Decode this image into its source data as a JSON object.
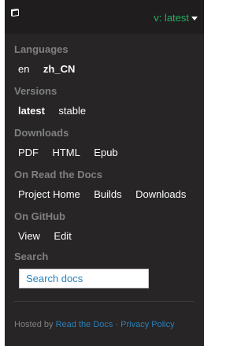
{
  "header": {
    "icon": "book-icon",
    "current_version_label": "v: latest"
  },
  "languages": {
    "heading": "Languages",
    "items": [
      "en",
      "zh_CN"
    ]
  },
  "versions": {
    "heading": "Versions",
    "items": [
      "latest",
      "stable"
    ]
  },
  "downloads": {
    "heading": "Downloads",
    "items": [
      "PDF",
      "HTML",
      "Epub"
    ]
  },
  "rtd": {
    "heading": "On Read the Docs",
    "items": [
      "Project Home",
      "Builds",
      "Downloads"
    ]
  },
  "github": {
    "heading": "On GitHub",
    "items": [
      "View",
      "Edit"
    ]
  },
  "search": {
    "heading": "Search",
    "placeholder": "Search docs"
  },
  "footer": {
    "prefix": "Hosted by ",
    "host_link": "Read the Docs",
    "separator": " · ",
    "privacy_link": "Privacy Policy"
  },
  "colors": {
    "panel_bg": "#272525",
    "topbar_bg": "#1f1d1d",
    "accent_green": "#27ae60",
    "link_blue": "#2980b9",
    "muted": "#808080"
  }
}
